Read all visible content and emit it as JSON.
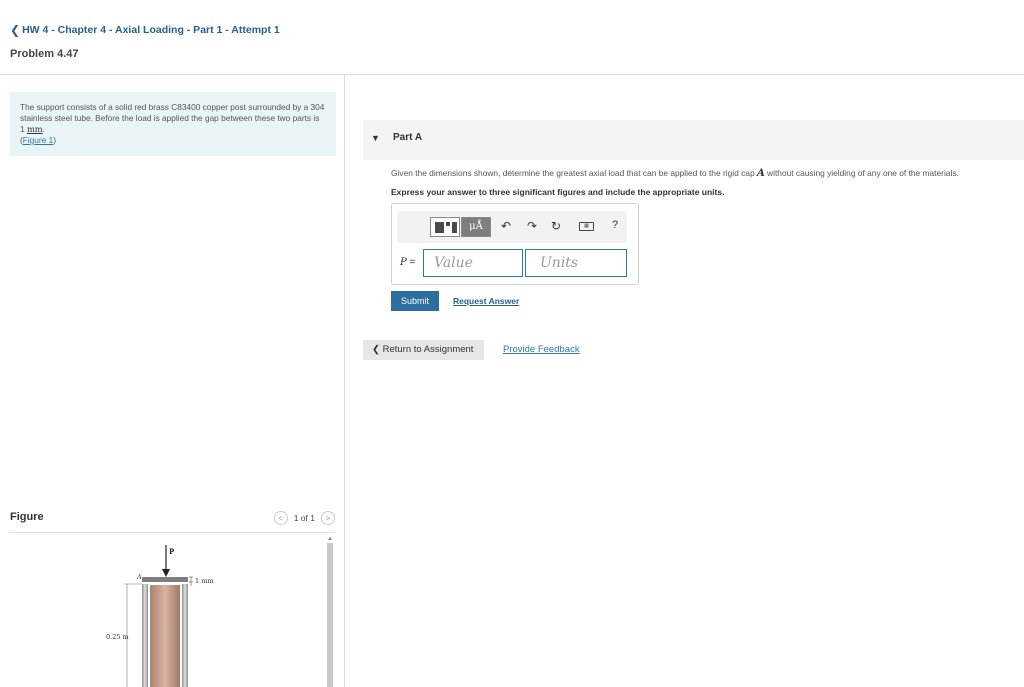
{
  "header": {
    "back_label": "HW 4 - Chapter 4 - Axial Loading - Part 1 - Attempt 1",
    "problem_title": "Problem 4.47"
  },
  "statement": {
    "text": "The support consists of a solid red brass C83400 copper post surrounded by a 304 stainless steel tube. Before the load is applied the gap between these two parts is 1",
    "unit": "mm",
    "end": ".",
    "figure_link": "Figure 1"
  },
  "figure": {
    "label": "Figure",
    "pager": "1 of 1",
    "labels": {
      "load": "P",
      "cap": "A",
      "gap": "1 mm",
      "length": "0.25 m"
    },
    "colors": {
      "post": "#c9a08e",
      "tube": "#b9b9b9"
    }
  },
  "part": {
    "title": "Part A",
    "question": "Given the dimensions shown, determine the greatest axial load that can be applied to the rigid cap",
    "question_var": "A",
    "question_end": "without causing yielding of any one of the materials.",
    "instruction": "Express your answer to three significant figures and include the appropriate units."
  },
  "answer": {
    "var": "P",
    "equals": " =",
    "value_placeholder": "Value",
    "units_placeholder": "Units",
    "toolbar": {
      "units_label": "μÅ",
      "undo": "undo-icon",
      "redo": "redo-icon",
      "reset": "reset-icon",
      "keyboard": "keyboard-icon",
      "help": "?"
    }
  },
  "actions": {
    "submit": "Submit",
    "request_answer": "Request Answer",
    "return": "Return to Assignment",
    "feedback": "Provide Feedback"
  }
}
